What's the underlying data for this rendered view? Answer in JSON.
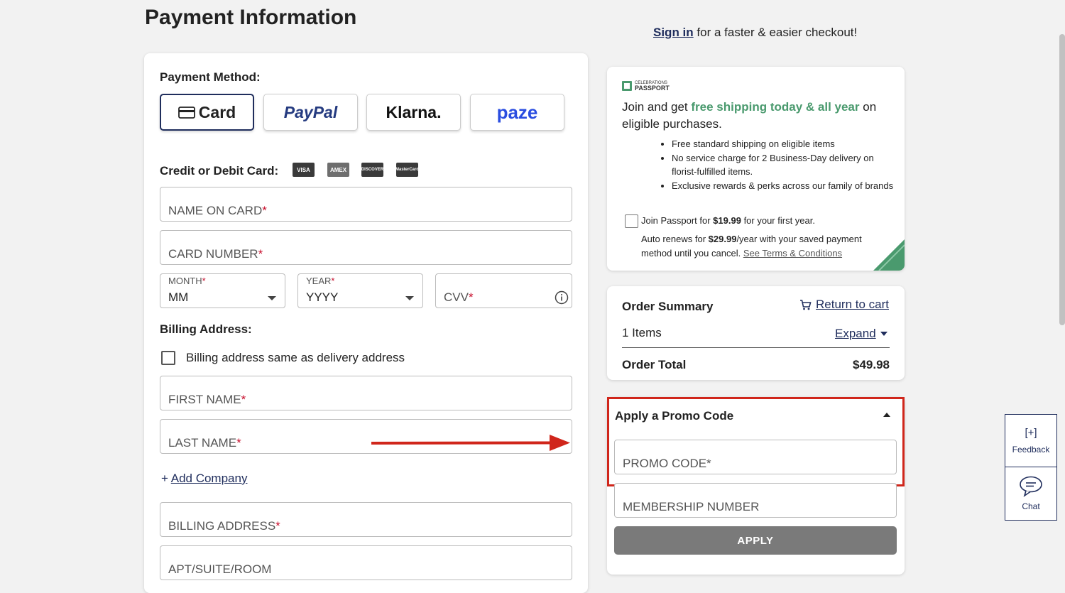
{
  "page": {
    "title": "Payment Information",
    "signin_link": "Sign in",
    "signin_suffix": "for a faster & easier checkout!"
  },
  "payment": {
    "method_label": "Payment Method:",
    "methods": [
      {
        "label": "Card",
        "selected": true
      },
      {
        "label": "PayPal"
      },
      {
        "label": "Klarna."
      },
      {
        "label": "paze"
      }
    ],
    "card_label": "Credit or Debit Card:",
    "card_logos": [
      "VISA",
      "AMEX",
      "DISCOVER",
      "MasterCard"
    ],
    "name_on_card": "NAME ON CARD",
    "card_number": "CARD NUMBER",
    "month_label": "MONTH",
    "month_value": "MM",
    "year_label": "YEAR",
    "year_value": "YYYY",
    "cvv": "CVV",
    "required_mark": "*"
  },
  "billing": {
    "label": "Billing Address:",
    "same_as_delivery": "Billing address same as delivery address",
    "first_name": "FIRST NAME",
    "last_name": "LAST NAME",
    "add_company_prefix": "+",
    "add_company": "Add Company",
    "billing_address": "BILLING ADDRESS",
    "apt": "APT/SUITE/ROOM"
  },
  "passport": {
    "brand_top": "CELEBRATIONS",
    "brand_bottom": "PASSPORT",
    "intro_1": "Join and get",
    "intro_highlight": "free shipping today & all year",
    "intro_2": "on",
    "intro_3": "eligible purchases.",
    "bullets": [
      "Free standard shipping on eligible items",
      "No service charge for 2 Business-Day delivery on florist-fulfilled items.",
      "Exclusive rewards & perks across our family of brands"
    ],
    "join_prefix": "Join Passport for",
    "join_price": "$19.99",
    "join_suffix": "for your first year.",
    "renew_prefix": "Auto renews for",
    "renew_price": "$29.99",
    "renew_mid": "/year with your saved payment",
    "renew_line2": "method until you cancel.",
    "terms_link": "See Terms & Conditions",
    "accent_color": "#4a9a6e"
  },
  "order_summary": {
    "title": "Order Summary",
    "return_link": "Return to cart",
    "items": "1 Items",
    "expand": "Expand",
    "total_label": "Order Total",
    "total_value": "$49.98"
  },
  "promo": {
    "title": "Apply a Promo Code",
    "promo_placeholder": "PROMO CODE*",
    "membership_placeholder": "MEMBERSHIP NUMBER",
    "apply_button": "APPLY",
    "highlight_color": "#d0261b"
  },
  "side_widgets": {
    "feedback_icon": "[+]",
    "feedback_label": "Feedback",
    "chat_label": "Chat"
  },
  "colors": {
    "brand_navy": "#1f2d5c",
    "required_red": "#c8102e",
    "annotation_red": "#d0261b"
  }
}
